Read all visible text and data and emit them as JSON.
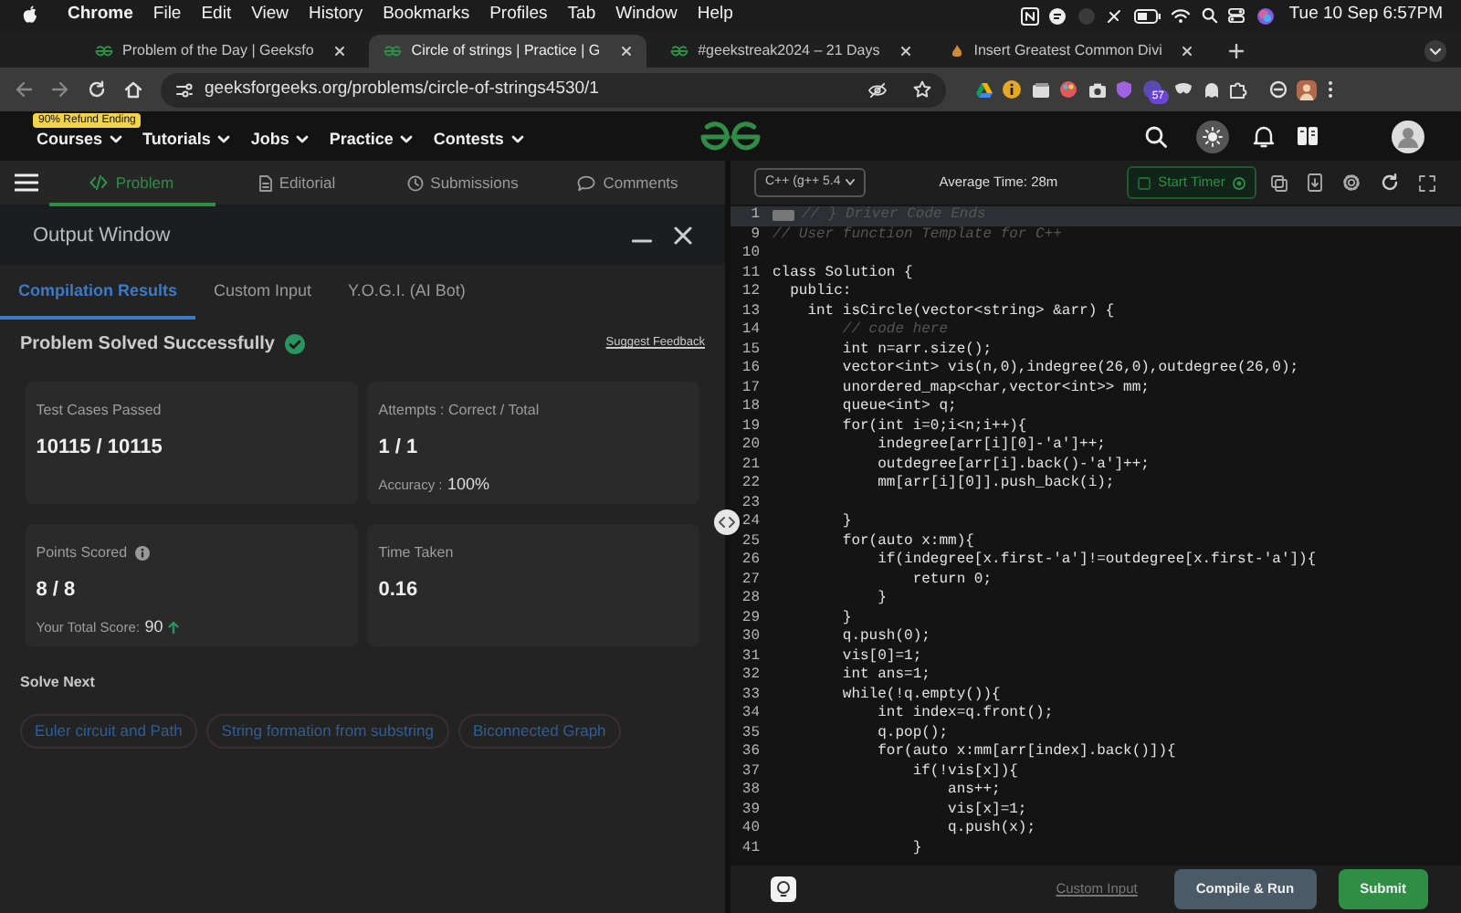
{
  "menu_bar": {
    "app": "Chrome",
    "items": [
      "File",
      "Edit",
      "View",
      "History",
      "Bookmarks",
      "Profiles",
      "Tab",
      "Window",
      "Help"
    ],
    "clock": "Tue 10 Sep 6:57PM"
  },
  "browser_tabs": [
    {
      "title": "Problem of the Day | Geeksfo",
      "selected": false
    },
    {
      "title": "Circle of strings | Practice | G",
      "selected": true
    },
    {
      "title": "#geekstreak2024 – 21 Days",
      "selected": false
    },
    {
      "title": "Insert Greatest Common Divi",
      "selected": false
    }
  ],
  "address_bar": {
    "url": "geeksforgeeks.org/problems/circle-of-strings4530/1",
    "extension_badge": "57"
  },
  "site_nav": {
    "promo_badge": "90% Refund Ending",
    "items": [
      "Courses",
      "Tutorials",
      "Jobs",
      "Practice",
      "Contests"
    ]
  },
  "problem_tabs": [
    {
      "label": "Problem",
      "selected": true
    },
    {
      "label": "Editorial",
      "selected": false
    },
    {
      "label": "Submissions",
      "selected": false
    },
    {
      "label": "Comments",
      "selected": false
    }
  ],
  "output_window": {
    "title": "Output Window",
    "tabs": [
      {
        "label": "Compilation Results",
        "selected": true
      },
      {
        "label": "Custom Input",
        "selected": false
      },
      {
        "label": "Y.O.G.I. (AI Bot)",
        "selected": false
      }
    ],
    "status": "Problem Solved Successfully",
    "feedback_link": "Suggest Feedback",
    "cards": [
      {
        "kind": "stat",
        "label": "Test Cases Passed",
        "value": "10115 / 10115"
      },
      {
        "kind": "stat",
        "label": "Attempts : Correct / Total",
        "value": "1 / 1",
        "note_label": "Accuracy :",
        "note_value": "100%"
      },
      {
        "kind": "points",
        "label": "Points Scored",
        "value": "8 / 8",
        "note_label": "Your Total Score:",
        "note_value": "90"
      },
      {
        "kind": "stat",
        "label": "Time Taken",
        "value": "0.16"
      }
    ],
    "solve_next": {
      "title": "Solve Next",
      "links": [
        "Euler circuit and Path",
        "String formation from substring",
        "Biconnected Graph"
      ]
    }
  },
  "editor": {
    "language": "C++ (g++ 5.4",
    "average_time": "Average Time: 28m",
    "timer_button": "Start Timer",
    "lines": [
      {
        "number": "1",
        "kind": "folded",
        "text": "// } Driver Code Ends",
        "active": true
      },
      {
        "number": "9",
        "kind": "comment",
        "text": "// User function Template for C++",
        "active": false
      },
      {
        "number": "10",
        "kind": "code",
        "active": false
      },
      {
        "number": "11",
        "kind": "code",
        "text": "class Solution {",
        "active": false
      },
      {
        "number": "12",
        "kind": "code",
        "text": "  public:",
        "active": false
      },
      {
        "number": "13",
        "kind": "code",
        "text": "    int isCircle(vector<string> &arr) {",
        "active": false
      },
      {
        "number": "14",
        "kind": "comment",
        "text": "        // code here",
        "active": false
      },
      {
        "number": "15",
        "kind": "code",
        "text": "        int n=arr.size();",
        "active": false
      },
      {
        "number": "16",
        "kind": "code",
        "text": "        vector<int> vis(n,0),indegree(26,0),outdegree(26,0);",
        "active": false
      },
      {
        "number": "17",
        "kind": "code",
        "text": "        unordered_map<char,vector<int>> mm;",
        "active": false
      },
      {
        "number": "18",
        "kind": "code",
        "text": "        queue<int> q;",
        "active": false
      },
      {
        "number": "19",
        "kind": "code",
        "text": "        for(int i=0;i<n;i++){",
        "active": false
      },
      {
        "number": "20",
        "kind": "code",
        "text": "            indegree[arr[i][0]-'a']++;",
        "active": false
      },
      {
        "number": "21",
        "kind": "code",
        "text": "            outdegree[arr[i].back()-'a']++;",
        "active": false
      },
      {
        "number": "22",
        "kind": "code",
        "text": "            mm[arr[i][0]].push_back(i);",
        "active": false
      },
      {
        "number": "23",
        "kind": "code",
        "active": false
      },
      {
        "number": "24",
        "kind": "code",
        "text": "        }",
        "active": false
      },
      {
        "number": "25",
        "kind": "code",
        "text": "        for(auto x:mm){",
        "active": false
      },
      {
        "number": "26",
        "kind": "code",
        "text": "            if(indegree[x.first-'a']!=outdegree[x.first-'a']){",
        "active": false
      },
      {
        "number": "27",
        "kind": "code",
        "text": "                return 0;",
        "active": false
      },
      {
        "number": "28",
        "kind": "code",
        "text": "            }",
        "active": false
      },
      {
        "number": "29",
        "kind": "code",
        "text": "        }",
        "active": false
      },
      {
        "number": "30",
        "kind": "code",
        "text": "        q.push(0);",
        "active": false
      },
      {
        "number": "31",
        "kind": "code",
        "text": "        vis[0]=1;",
        "active": false
      },
      {
        "number": "32",
        "kind": "code",
        "text": "        int ans=1;",
        "active": false
      },
      {
        "number": "33",
        "kind": "code",
        "text": "        while(!q.empty()){",
        "active": false
      },
      {
        "number": "34",
        "kind": "code",
        "text": "            int index=q.front();",
        "active": false
      },
      {
        "number": "35",
        "kind": "code",
        "text": "            q.pop();",
        "active": false
      },
      {
        "number": "36",
        "kind": "code",
        "text": "            for(auto x:mm[arr[index].back()]){",
        "active": false
      },
      {
        "number": "37",
        "kind": "code",
        "text": "                if(!vis[x]){",
        "active": false
      },
      {
        "number": "38",
        "kind": "code",
        "text": "                    ans++;",
        "active": false
      },
      {
        "number": "39",
        "kind": "code",
        "text": "                    vis[x]=1;",
        "active": false
      },
      {
        "number": "40",
        "kind": "code",
        "text": "                    q.push(x);",
        "active": false
      },
      {
        "number": "41",
        "kind": "code",
        "text": "                }",
        "active": false
      }
    ]
  },
  "footer": {
    "custom_input": "Custom Input",
    "compile_button": "Compile & Run",
    "submit_button": "Submit"
  }
}
